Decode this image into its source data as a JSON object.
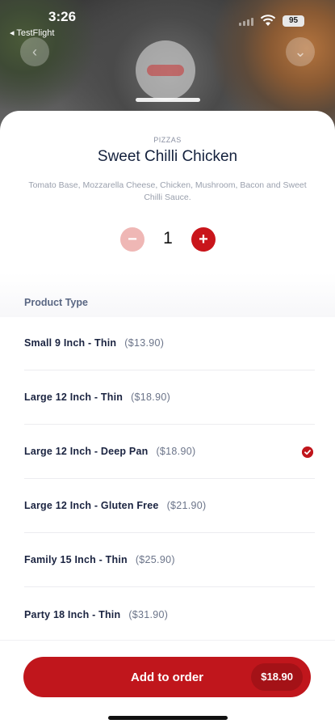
{
  "status_bar": {
    "time": "3:26",
    "back_app": "◂ TestFlight",
    "battery": "95"
  },
  "product": {
    "category": "PIZZAS",
    "title": "Sweet Chilli Chicken",
    "description": "Tomato Base, Mozzarella Cheese, Chicken, Mushroom, Bacon and Sweet Chilli Sauce."
  },
  "quantity": {
    "value": "1",
    "minus_symbol": "−",
    "plus_symbol": "+"
  },
  "product_type": {
    "heading": "Product Type",
    "options": [
      {
        "name": "Small 9 Inch - Thin",
        "price": "($13.90)",
        "selected": false
      },
      {
        "name": "Large 12 Inch - Thin",
        "price": "($18.90)",
        "selected": false
      },
      {
        "name": "Large 12 Inch - Deep Pan",
        "price": "($18.90)",
        "selected": true
      },
      {
        "name": "Large 12 Inch - Gluten Free",
        "price": "($21.90)",
        "selected": false
      },
      {
        "name": "Family 15 Inch - Thin",
        "price": "($25.90)",
        "selected": false
      },
      {
        "name": "Party 18 Inch - Thin",
        "price": "($31.90)",
        "selected": false
      }
    ]
  },
  "footer": {
    "add_label": "Add to order",
    "total": "$18.90"
  },
  "colors": {
    "accent": "#c0161c",
    "text_dark": "#14213d",
    "text_muted": "#6b7489"
  }
}
